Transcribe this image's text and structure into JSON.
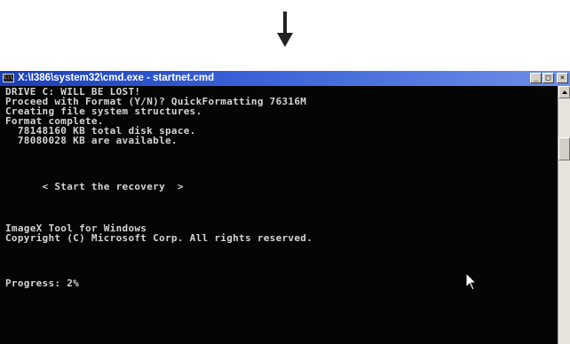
{
  "window": {
    "title": "X:\\I386\\system32\\cmd.exe - startnet.cmd",
    "icon_name": "cmd-icon",
    "icon_text": "C:\\"
  },
  "console": {
    "lines": [
      "DRIVE C: WILL BE LOST!",
      "Proceed with Format (Y/N)? QuickFormatting 76316M",
      "Creating file system structures.",
      "Format complete.",
      "  78148160 KB total disk space.",
      "  78080028 KB are available.",
      "      < Start the recovery  >",
      "ImageX Tool for Windows",
      "Copyright (C) Microsoft Corp. All rights reserved.",
      "Progress: 2%"
    ]
  },
  "progress": {
    "percent": 2
  },
  "colors": {
    "console_bg": "#050505",
    "console_text": "#d4d4d4",
    "titlebar_start": "#1a3fb8",
    "titlebar_end": "#6d8fe8"
  },
  "icons": {
    "arrow": "arrow-down-icon",
    "cursor": "mouse-pointer-icon"
  }
}
